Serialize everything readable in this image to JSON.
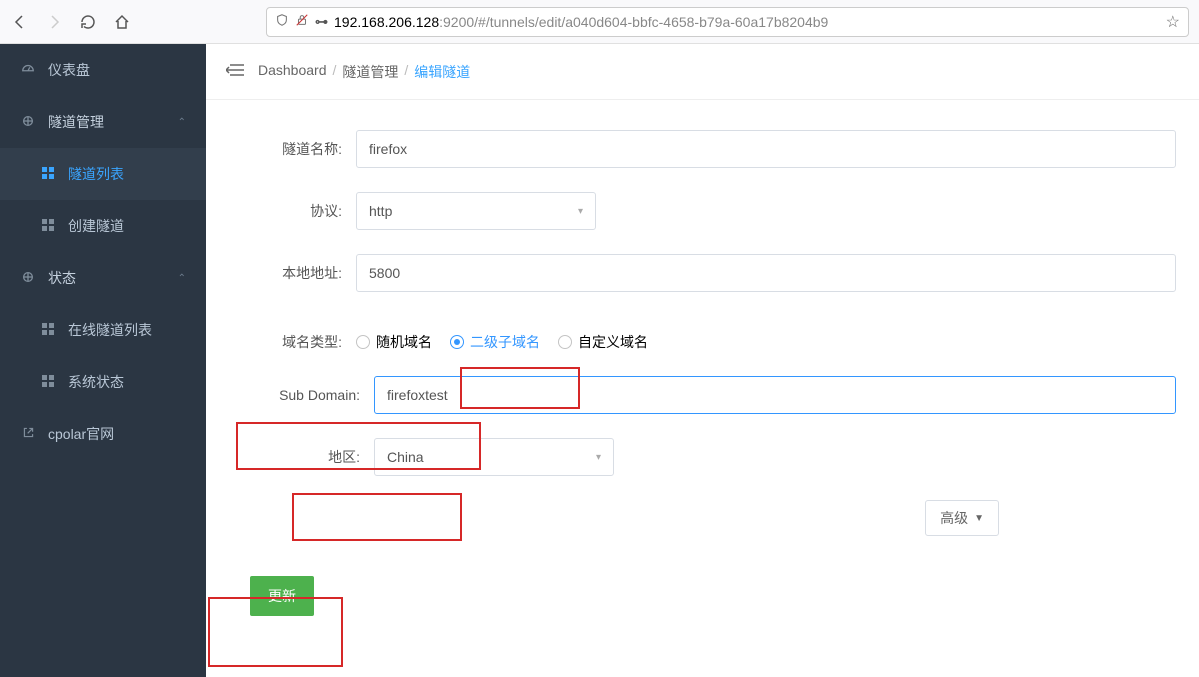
{
  "browser": {
    "url_host": "192.168.206.128",
    "url_path": ":9200/#/tunnels/edit/a040d604-bbfc-4658-b79a-60a17b8204b9"
  },
  "sidebar": {
    "items": [
      {
        "icon": "dashboard",
        "label": "仪表盘"
      },
      {
        "icon": "tunnel",
        "label": "隧道管理",
        "expanded": true
      },
      {
        "icon": "grid",
        "label": "隧道列表",
        "sub": true,
        "active": true
      },
      {
        "icon": "grid",
        "label": "创建隧道",
        "sub": true
      },
      {
        "icon": "status",
        "label": "状态",
        "expanded": true
      },
      {
        "icon": "grid",
        "label": "在线隧道列表",
        "sub": true
      },
      {
        "icon": "grid",
        "label": "系统状态",
        "sub": true
      },
      {
        "icon": "link",
        "label": "cpolar官网"
      }
    ]
  },
  "breadcrumb": {
    "root": "Dashboard",
    "mid": "隧道管理",
    "current": "编辑隧道"
  },
  "form": {
    "name_label": "隧道名称:",
    "name_value": "firefox",
    "protocol_label": "协议:",
    "protocol_value": "http",
    "local_label": "本地地址:",
    "local_value": "5800",
    "domain_type_label": "域名类型:",
    "domain_type_options": [
      {
        "label": "随机域名",
        "selected": false
      },
      {
        "label": "二级子域名",
        "selected": true
      },
      {
        "label": "自定义域名",
        "selected": false
      }
    ],
    "subdomain_label": "Sub Domain:",
    "subdomain_value": "firefoxtest",
    "region_label": "地区:",
    "region_value": "China",
    "advanced_label": "高级",
    "submit_label": "更新"
  }
}
